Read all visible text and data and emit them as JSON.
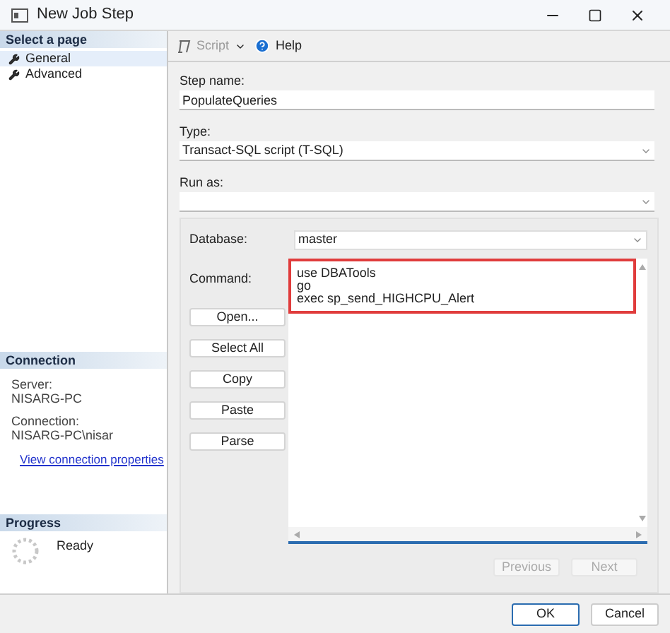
{
  "window": {
    "title": "New Job Step"
  },
  "sidebar": {
    "header": "Select a page",
    "items": [
      {
        "label": "General",
        "selected": true
      },
      {
        "label": "Advanced",
        "selected": false
      }
    ]
  },
  "connection": {
    "header": "Connection",
    "fields": [
      {
        "label": "Server:",
        "value": "NISARG-PC"
      },
      {
        "label": "Connection:",
        "value": "NISARG-PC\\nisar"
      }
    ],
    "link": "View connection properties"
  },
  "progress": {
    "header": "Progress",
    "status": "Ready"
  },
  "toolbar": {
    "script": {
      "label": "Script",
      "disabled": true
    },
    "help": "Help"
  },
  "form": {
    "step_name": {
      "label": "Step name:",
      "value": "PopulateQueries"
    },
    "type": {
      "label": "Type:",
      "value": "Transact-SQL script (T-SQL)"
    },
    "run_as": {
      "label": "Run as:"
    },
    "database": {
      "label": "Database:",
      "value": "master"
    },
    "command": {
      "label": "Command:",
      "lines": [
        "use DBATools",
        "go",
        "exec sp_send_HIGHCPU_Alert"
      ],
      "highlighted": true
    }
  },
  "command_buttons": [
    "Open...",
    "Select All",
    "Copy",
    "Paste",
    "Parse"
  ],
  "nav_buttons": [
    {
      "label": "Previous",
      "disabled": true
    },
    {
      "label": "Next",
      "disabled": true
    }
  ],
  "footer_buttons": [
    "OK",
    "Cancel"
  ]
}
